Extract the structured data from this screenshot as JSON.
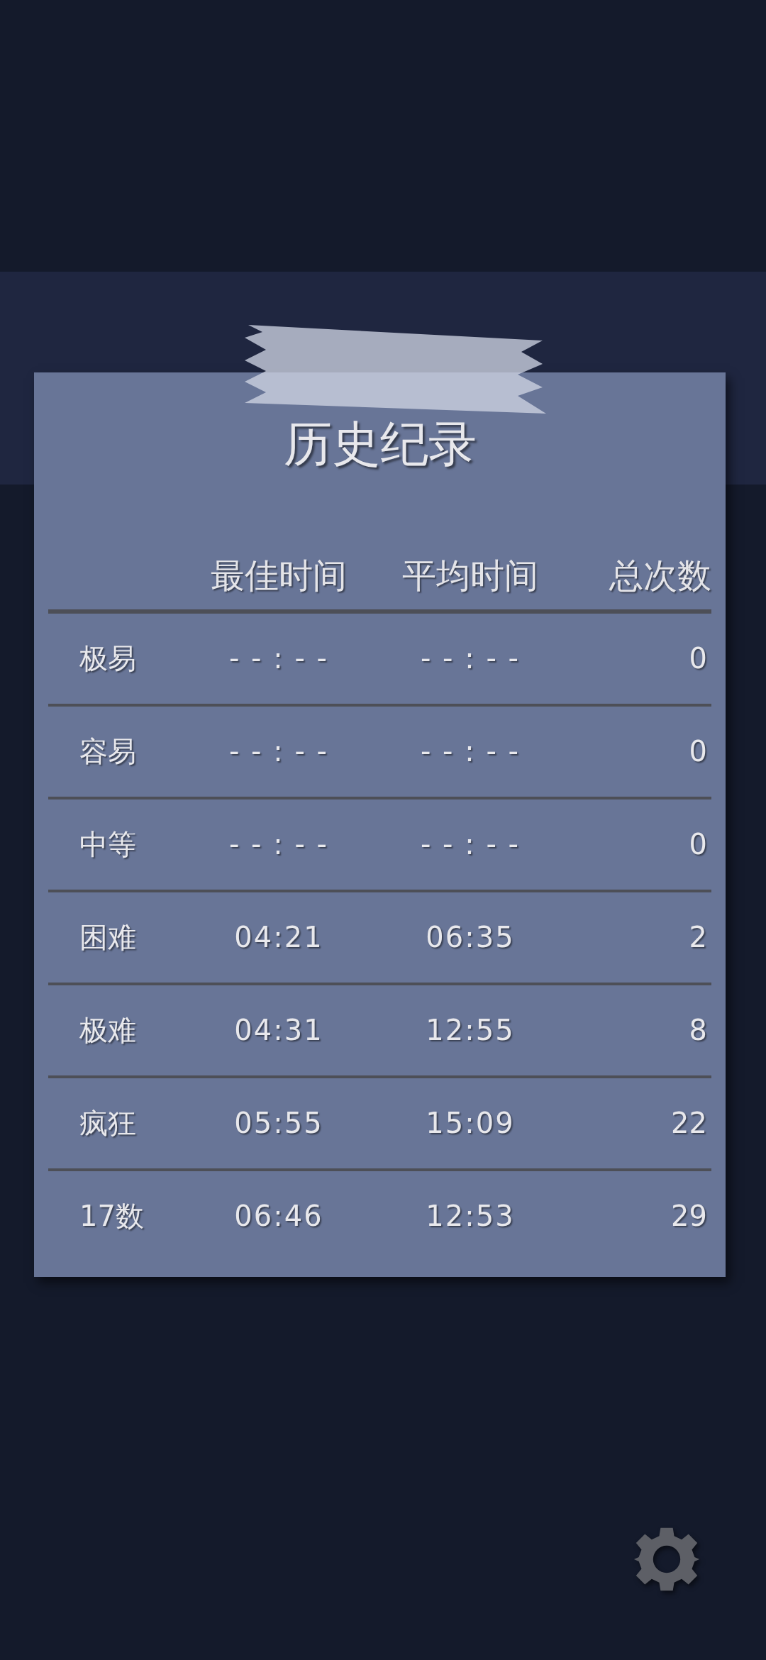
{
  "history": {
    "title": "历史纪录",
    "columns": [
      "最佳时间",
      "平均时间",
      "总次数"
    ],
    "rows": [
      {
        "level": "极易",
        "best": "- - : - -",
        "average": "- - : - -",
        "count": "0"
      },
      {
        "level": "容易",
        "best": "- - : - -",
        "average": "- - : - -",
        "count": "0"
      },
      {
        "level": "中等",
        "best": "- - : - -",
        "average": "- - : - -",
        "count": "0"
      },
      {
        "level": "困难",
        "best": "04:21",
        "average": "06:35",
        "count": "2"
      },
      {
        "level": "极难",
        "best": "04:31",
        "average": "12:55",
        "count": "8"
      },
      {
        "level": "疯狂",
        "best": "05:55",
        "average": "15:09",
        "count": "22"
      },
      {
        "level": "17数",
        "best": "06:46",
        "average": "12:53",
        "count": "29"
      }
    ]
  }
}
